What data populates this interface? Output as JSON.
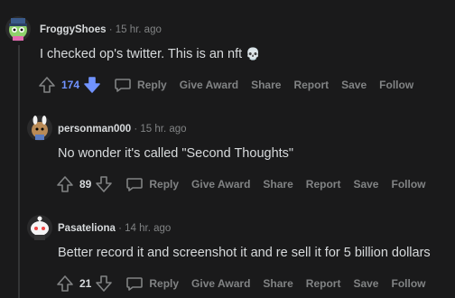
{
  "comments": [
    {
      "author": "FroggyShoes",
      "time": "· 15 hr. ago",
      "text": "I checked op's twitter. This is an nft ",
      "emoji": "💀",
      "votes": "174",
      "voted": "down",
      "actions": {
        "reply": "Reply",
        "give_award": "Give Award",
        "share": "Share",
        "report": "Report",
        "save": "Save",
        "follow": "Follow"
      }
    },
    {
      "author": "personman000",
      "time": "· 15 hr. ago",
      "text": "No wonder it's called \"Second Thoughts\"",
      "votes": "89",
      "actions": {
        "reply": "Reply",
        "give_award": "Give Award",
        "share": "Share",
        "report": "Report",
        "save": "Save",
        "follow": "Follow"
      }
    },
    {
      "author": "Pasateliona",
      "time": "· 14 hr. ago",
      "text": "Better record it and screenshot it and re sell it for 5 billion dollars",
      "votes": "21",
      "actions": {
        "reply": "Reply",
        "give_award": "Give Award",
        "share": "Share",
        "report": "Report",
        "save": "Save",
        "follow": "Follow"
      }
    }
  ],
  "colors": {
    "accent_blue": "#7193ff",
    "text": "#d7dadc",
    "muted": "#818384",
    "bg": "#1a1a1b"
  },
  "icons": [
    "upvote-icon",
    "downvote-icon",
    "reply-icon",
    "skull-icon"
  ]
}
